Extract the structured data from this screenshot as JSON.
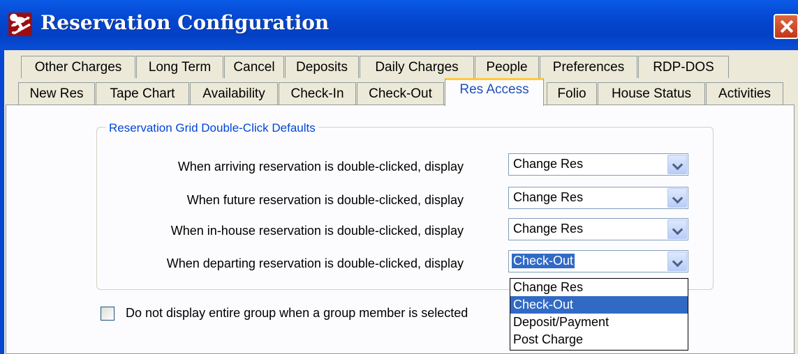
{
  "window": {
    "title": "Reservation Configuration",
    "app_icon": "skier-logo-icon",
    "close_icon": "close-icon"
  },
  "tabs_row1": [
    "Other Charges",
    "Long Term",
    "Cancel",
    "Deposits",
    "Daily Charges",
    "People",
    "Preferences",
    "RDP-DOS"
  ],
  "tabs_row2": [
    "New Res",
    "Tape Chart",
    "Availability",
    "Check-In",
    "Check-Out",
    "Res Access",
    "Folio",
    "House Status",
    "Activities"
  ],
  "active_tab": "Res Access",
  "group": {
    "title": "Reservation Grid Double-Click Defaults",
    "rows": [
      {
        "label": "When arriving reservation is double-clicked, display",
        "value": "Change Res"
      },
      {
        "label": "When future reservation is double-clicked, display",
        "value": "Change Res"
      },
      {
        "label": "When in-house reservation is double-clicked, display",
        "value": "Change Res"
      },
      {
        "label": "When departing reservation is double-clicked, display",
        "value": "Check-Out"
      }
    ]
  },
  "dropdown": {
    "options": [
      "Change Res",
      "Check-Out",
      "Deposit/Payment",
      "Post Charge"
    ],
    "highlighted": "Check-Out"
  },
  "checkbox": {
    "label": "Do not display entire group when a group member is selected",
    "checked": false
  },
  "colors": {
    "titlebar": "#0446cf",
    "active_tab_accent": "#ffc83c",
    "group_title": "#0046d5",
    "selection": "#316ac5"
  }
}
